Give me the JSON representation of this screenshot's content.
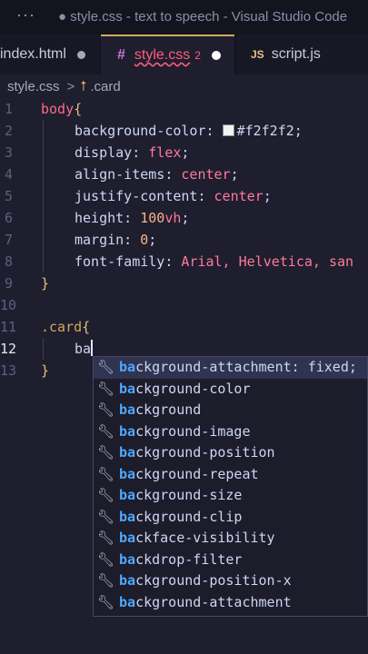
{
  "window": {
    "menu_icon": "ellipsis-icon",
    "title": "● style.css - text to speech - Visual Studio Code"
  },
  "tabs": [
    {
      "label": "index.html",
      "modified": true
    },
    {
      "icon": "#",
      "label": "style.css",
      "problems": "2",
      "modified": true,
      "active": true
    },
    {
      "icon": "JS",
      "label": "script.js"
    }
  ],
  "breadcrumb": {
    "file": "style.css",
    "separator": ">",
    "symbol_icon": "css-symbol-icon",
    "symbol": ".card"
  },
  "editor": {
    "lines": [
      {
        "n": "1",
        "selector": "body",
        "brace": "{"
      },
      {
        "n": "2",
        "prop": "background-color:",
        "swatch": "#f2f2f2",
        "val": "#f2f2f2",
        "end": ";"
      },
      {
        "n": "3",
        "prop": "display:",
        "val": "flex",
        "end": ";"
      },
      {
        "n": "4",
        "prop": "align-items:",
        "val": "center",
        "end": ";"
      },
      {
        "n": "5",
        "prop": "justify-content:",
        "val": "center",
        "end": ";"
      },
      {
        "n": "6",
        "prop": "height:",
        "num": "100",
        "unit": "vh",
        "end": ";"
      },
      {
        "n": "7",
        "prop": "margin:",
        "num": "0",
        "end": ";"
      },
      {
        "n": "8",
        "prop": "font-family:",
        "val": "Arial, Helvetica, san"
      },
      {
        "n": "9",
        "brace": "}"
      },
      {
        "n": "10"
      },
      {
        "n": "11",
        "selector": ".card",
        "brace": "{"
      },
      {
        "n": "12",
        "typed": "ba"
      },
      {
        "n": "13",
        "brace": "}"
      }
    ]
  },
  "suggestions": {
    "match": "ba",
    "items": [
      {
        "rest": "ckground-attachment: fixed;",
        "selected": true
      },
      {
        "rest": "ckground-color"
      },
      {
        "rest": "ckground"
      },
      {
        "rest": "ckground-image"
      },
      {
        "rest": "ckground-position"
      },
      {
        "rest": "ckground-repeat"
      },
      {
        "rest": "ckground-size"
      },
      {
        "rest": "ckground-clip"
      },
      {
        "rest": "ckface-visibility"
      },
      {
        "rest": "ckdrop-filter"
      },
      {
        "rest": "ckground-position-x"
      },
      {
        "rest": "ckground-attachment"
      }
    ]
  }
}
